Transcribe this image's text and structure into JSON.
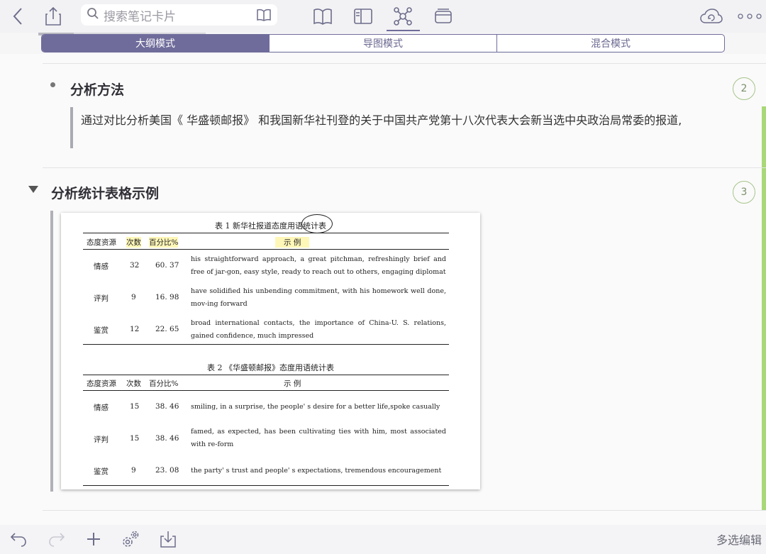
{
  "toolbar": {
    "search_placeholder": "搜索笔记卡片",
    "icons": [
      "back-chevron-icon",
      "share-icon",
      "search-icon",
      "book-icon",
      "outline-book-icon",
      "panel-icon",
      "mindmap-icon",
      "cards-icon",
      "cloud-sync-icon",
      "more-icon"
    ],
    "accent": "#6f6c9b"
  },
  "progress": {
    "value": 0.21
  },
  "modes": [
    "大纲模式",
    "导图模式",
    "混合模式"
  ],
  "outline": {
    "item2": {
      "title": "分析方法",
      "text": "通过对比分析美国《 华盛顿邮报》 和我国新华社刊登的关于中国共产党第十八次代表大会新当选中央政治局常委的报道,",
      "badge": "2"
    },
    "item3": {
      "title": "分析统计表格示例",
      "badge": "3"
    }
  },
  "figure": {
    "table1": {
      "caption": "表 1    新华社报道态度用语统计表",
      "headers": [
        "态度资源",
        "次数",
        "百分比%",
        "示          例"
      ],
      "rows": [
        [
          "情感",
          "32",
          "60. 37",
          "his straightforward approach, a great pitchman, refreshingly brief and free of jar-gon, easy style, ready to reach out to others, engaging diplomat"
        ],
        [
          "评判",
          "9",
          "16. 98",
          "have solidified his unbending commitment, with his homework well done, mov-ing forward"
        ],
        [
          "鉴赏",
          "12",
          "22. 65",
          "broad international contacts, the importance of China-U. S. relations, gained confidence, much impressed"
        ]
      ]
    },
    "table2": {
      "caption": "表 2    《华盛顿邮报》态度用语统计表",
      "headers": [
        "态度资源",
        "次数",
        "百分比%",
        "示          例"
      ],
      "rows": [
        [
          "情感",
          "15",
          "38. 46",
          "smiling, in a surprise, the people' s desire for a better life,spoke casually"
        ],
        [
          "评判",
          "15",
          "38. 46",
          "famed, as expected, has been cultivating ties with him, most associated with re-form"
        ],
        [
          "鉴赏",
          "9",
          "23. 08",
          "the party' s trust and people' s expectations, tremendous encouragement"
        ]
      ]
    }
  },
  "bottom": {
    "icons": [
      "undo-icon",
      "redo-icon",
      "add-icon",
      "settings-icon",
      "import-icon"
    ],
    "multi_edit": "多选编辑"
  }
}
